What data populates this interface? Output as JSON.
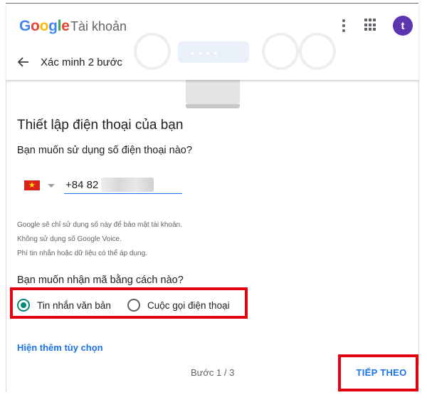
{
  "header": {
    "logo_letters": [
      "G",
      "o",
      "o",
      "g",
      "l",
      "e"
    ],
    "product": "Tài khoản",
    "avatar_letter": "t",
    "subtitle": "Xác minh 2 bước",
    "icons": [
      "more-vert-icon",
      "apps-icon",
      "arrow-back-icon"
    ]
  },
  "main": {
    "title": "Thiết lập điện thoại của bạn",
    "phone_question": "Bạn muốn sử dụng số điện thoại nào?",
    "country_flag": "vietnam-flag-icon",
    "phone_value": "+84 82",
    "notes": [
      "Google sẽ chỉ sử dụng số này để bảo mật tài khoản.",
      "Không sử dụng số Google Voice.",
      "Phí tin nhắn hoặc dữ liệu có thể áp dụng."
    ],
    "method_question": "Bạn muốn nhận mã bằng cách nào?",
    "options": [
      {
        "label": "Tin nhắn văn bản",
        "selected": true
      },
      {
        "label": "Cuộc gọi điện thoại",
        "selected": false
      }
    ],
    "more_options": "Hiện thêm tùy chọn",
    "step": "Bước 1 / 3",
    "next_label": "TIẾP THEO"
  },
  "colors": {
    "accent": "#1a73e8",
    "radio_selected": "#00897b",
    "highlight": "#e3000f",
    "avatar": "#5e35b1"
  }
}
